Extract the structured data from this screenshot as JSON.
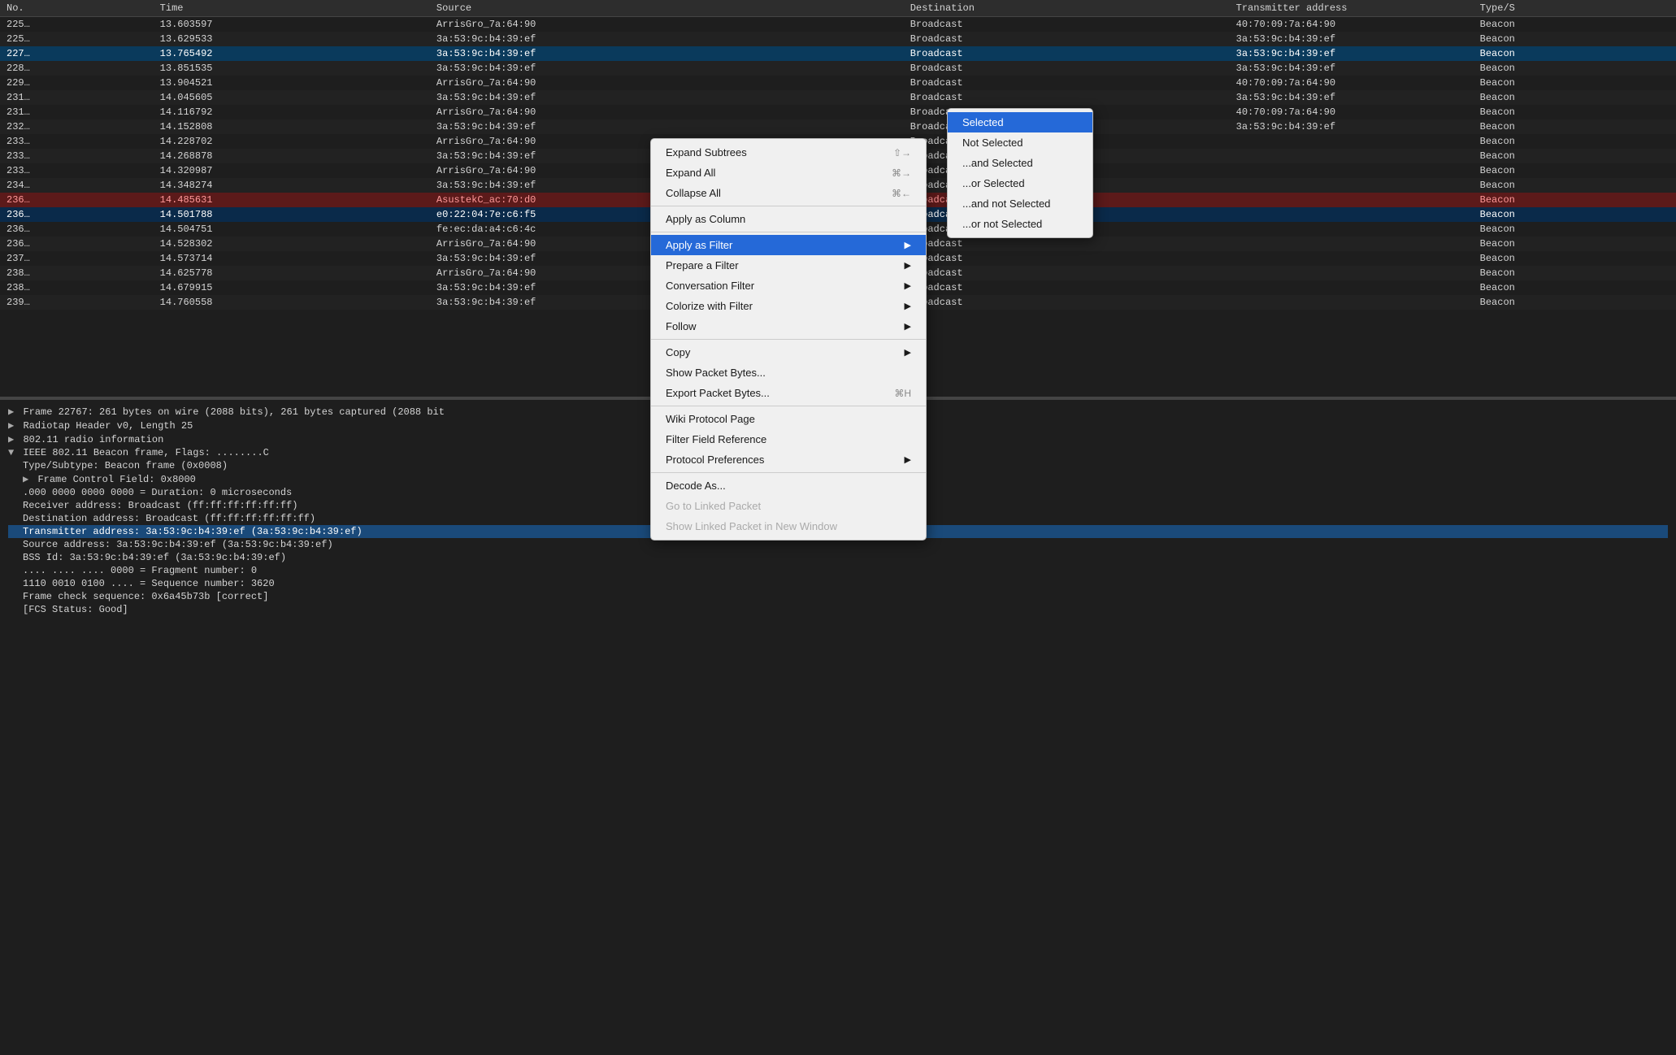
{
  "columns": [
    "No.",
    "Time",
    "Source",
    "Destination",
    "Transmitter address",
    "Type/S"
  ],
  "rows": [
    {
      "no": "225…",
      "time": "13.603597",
      "source": "ArrisGro_7a:64:90",
      "dest": "Broadcast",
      "transmitter": "40:70:09:7a:64:90",
      "type": "Beacon"
    },
    {
      "no": "225…",
      "time": "13.629533",
      "source": "3a:53:9c:b4:39:ef",
      "dest": "Broadcast",
      "transmitter": "3a:53:9c:b4:39:ef",
      "type": "Beacon"
    },
    {
      "no": "227…",
      "time": "13.765492",
      "source": "3a:53:9c:b4:39:ef",
      "dest": "Broadcast",
      "transmitter": "3a:53:9c:b4:39:ef",
      "type": "Beacon",
      "highlight": "selected"
    },
    {
      "no": "228…",
      "time": "13.851535",
      "source": "3a:53:9c:b4:39:ef",
      "dest": "Broadcast",
      "transmitter": "3a:53:9c:b4:39:ef",
      "type": "Beacon"
    },
    {
      "no": "229…",
      "time": "13.904521",
      "source": "ArrisGro_7a:64:90",
      "dest": "Broadcast",
      "transmitter": "40:70:09:7a:64:90",
      "type": "Beacon"
    },
    {
      "no": "231…",
      "time": "14.045605",
      "source": "3a:53:9c:b4:39:ef",
      "dest": "Broadcast",
      "transmitter": "3a:53:9c:b4:39:ef",
      "type": "Beacon"
    },
    {
      "no": "231…",
      "time": "14.116792",
      "source": "ArrisGro_7a:64:90",
      "dest": "Broadcast",
      "transmitter": "40:70:09:7a:64:90",
      "type": "Beacon"
    },
    {
      "no": "232…",
      "time": "14.152808",
      "source": "3a:53:9c:b4:39:ef",
      "dest": "Broadcast",
      "transmitter": "3a:53:9c:b4:39:ef",
      "type": "Beacon"
    },
    {
      "no": "233…",
      "time": "14.228702",
      "source": "ArrisGro_7a:64:90",
      "dest": "Broadcast",
      "transmitter": "",
      "type": "Beacon"
    },
    {
      "no": "233…",
      "time": "14.268878",
      "source": "3a:53:9c:b4:39:ef",
      "dest": "Broadcast",
      "transmitter": "",
      "type": "Beacon"
    },
    {
      "no": "233…",
      "time": "14.320987",
      "source": "ArrisGro_7a:64:90",
      "dest": "Broadcast",
      "transmitter": "",
      "type": "Beacon"
    },
    {
      "no": "234…",
      "time": "14.348274",
      "source": "3a:53:9c:b4:39:ef",
      "dest": "Broadcast",
      "transmitter": "",
      "type": "Beacon"
    },
    {
      "no": "236…",
      "time": "14.485631",
      "source": "AsustekC_ac:70:d0",
      "dest": "Broadcast",
      "transmitter": "",
      "type": "Beacon",
      "highlight": "red"
    },
    {
      "no": "236…",
      "time": "14.501788",
      "source": "e0:22:04:7e:c6:f5",
      "dest": "Broadcast",
      "transmitter": "",
      "type": "Beacon",
      "highlight": "dark"
    },
    {
      "no": "236…",
      "time": "14.504751",
      "source": "fe:ec:da:a4:c6:4c",
      "dest": "Broadcast",
      "transmitter": "",
      "type": "Beacon"
    },
    {
      "no": "236…",
      "time": "14.528302",
      "source": "ArrisGro_7a:64:90",
      "dest": "Broadcast",
      "transmitter": "",
      "type": "Beacon"
    },
    {
      "no": "237…",
      "time": "14.573714",
      "source": "3a:53:9c:b4:39:ef",
      "dest": "Broadcast",
      "transmitter": "",
      "type": "Beacon"
    },
    {
      "no": "238…",
      "time": "14.625778",
      "source": "ArrisGro_7a:64:90",
      "dest": "Broadcast",
      "transmitter": "",
      "type": "Beacon"
    },
    {
      "no": "238…",
      "time": "14.679915",
      "source": "3a:53:9c:b4:39:ef",
      "dest": "Broadcast",
      "transmitter": "",
      "type": "Beacon"
    },
    {
      "no": "239…",
      "time": "14.760558",
      "source": "3a:53:9c:b4:39:ef",
      "dest": "Broadcast",
      "transmitter": "",
      "type": "Beacon"
    }
  ],
  "detail_lines": [
    {
      "text": "Frame 22767: 261 bytes on wire (2088 bits), 261 bytes captured (2088 bit",
      "indent": 0,
      "arrow": "▶",
      "selected": false
    },
    {
      "text": "Radiotap Header v0, Length 25",
      "indent": 0,
      "arrow": "▶",
      "selected": false
    },
    {
      "text": "802.11 radio information",
      "indent": 0,
      "arrow": "▶",
      "selected": false
    },
    {
      "text": "IEEE 802.11 Beacon frame, Flags: ........C",
      "indent": 0,
      "arrow": "▼",
      "selected": false
    },
    {
      "text": "Type/Subtype: Beacon frame (0x0008)",
      "indent": 1,
      "arrow": "",
      "selected": false
    },
    {
      "text": "Frame Control Field: 0x8000",
      "indent": 1,
      "arrow": "▶",
      "selected": false
    },
    {
      "text": ".000 0000 0000 0000 = Duration: 0 microseconds",
      "indent": 1,
      "arrow": "",
      "selected": false
    },
    {
      "text": "Receiver address: Broadcast (ff:ff:ff:ff:ff:ff)",
      "indent": 1,
      "arrow": "",
      "selected": false
    },
    {
      "text": "Destination address: Broadcast (ff:ff:ff:ff:ff:ff)",
      "indent": 1,
      "arrow": "",
      "selected": false
    },
    {
      "text": "Transmitter address: 3a:53:9c:b4:39:ef (3a:53:9c:b4:39:ef)",
      "indent": 1,
      "arrow": "",
      "selected": true
    },
    {
      "text": "Source address: 3a:53:9c:b4:39:ef (3a:53:9c:b4:39:ef)",
      "indent": 1,
      "arrow": "",
      "selected": false
    },
    {
      "text": "BSS Id: 3a:53:9c:b4:39:ef (3a:53:9c:b4:39:ef)",
      "indent": 1,
      "arrow": "",
      "selected": false
    },
    {
      "text": ".... .... .... 0000 = Fragment number: 0",
      "indent": 1,
      "arrow": "",
      "selected": false
    },
    {
      "text": "1110 0010 0100 .... = Sequence number: 3620",
      "indent": 1,
      "arrow": "",
      "selected": false
    },
    {
      "text": "Frame check sequence: 0x6a45b73b [correct]",
      "indent": 1,
      "arrow": "",
      "selected": false
    },
    {
      "text": "[FCS Status: Good]",
      "indent": 1,
      "arrow": "",
      "selected": false
    }
  ],
  "context_menu": {
    "items": [
      {
        "label": "Expand Subtrees",
        "shortcut": "⇧→",
        "has_submenu": false,
        "disabled": false,
        "separator_after": false
      },
      {
        "label": "Expand All",
        "shortcut": "⌘→",
        "has_submenu": false,
        "disabled": false,
        "separator_after": false
      },
      {
        "label": "Collapse All",
        "shortcut": "⌘←",
        "has_submenu": false,
        "disabled": false,
        "separator_after": true
      },
      {
        "label": "Apply as Column",
        "shortcut": "",
        "has_submenu": false,
        "disabled": false,
        "separator_after": true
      },
      {
        "label": "Apply as Filter",
        "shortcut": "",
        "has_submenu": true,
        "disabled": false,
        "active": true,
        "separator_after": false
      },
      {
        "label": "Prepare a Filter",
        "shortcut": "",
        "has_submenu": true,
        "disabled": false,
        "separator_after": false
      },
      {
        "label": "Conversation Filter",
        "shortcut": "",
        "has_submenu": true,
        "disabled": false,
        "separator_after": false
      },
      {
        "label": "Colorize with Filter",
        "shortcut": "",
        "has_submenu": true,
        "disabled": false,
        "separator_after": false
      },
      {
        "label": "Follow",
        "shortcut": "",
        "has_submenu": true,
        "disabled": false,
        "separator_after": true
      },
      {
        "label": "Copy",
        "shortcut": "",
        "has_submenu": true,
        "disabled": false,
        "separator_after": false
      },
      {
        "label": "Show Packet Bytes...",
        "shortcut": "",
        "has_submenu": false,
        "disabled": false,
        "separator_after": false
      },
      {
        "label": "Export Packet Bytes...",
        "shortcut": "⌘H",
        "has_submenu": false,
        "disabled": false,
        "separator_after": true
      },
      {
        "label": "Wiki Protocol Page",
        "shortcut": "",
        "has_submenu": false,
        "disabled": false,
        "separator_after": false
      },
      {
        "label": "Filter Field Reference",
        "shortcut": "",
        "has_submenu": false,
        "disabled": false,
        "separator_after": false
      },
      {
        "label": "Protocol Preferences",
        "shortcut": "",
        "has_submenu": true,
        "disabled": false,
        "separator_after": true
      },
      {
        "label": "Decode As...",
        "shortcut": "",
        "has_submenu": false,
        "disabled": false,
        "separator_after": false
      },
      {
        "label": "Go to Linked Packet",
        "shortcut": "",
        "has_submenu": false,
        "disabled": true,
        "separator_after": false
      },
      {
        "label": "Show Linked Packet in New Window",
        "shortcut": "",
        "has_submenu": false,
        "disabled": true,
        "separator_after": false
      }
    ]
  },
  "apply_filter_submenu": {
    "items": [
      {
        "label": "Selected",
        "active": true
      },
      {
        "label": "Not Selected",
        "active": false
      },
      {
        "label": "...and Selected",
        "active": false
      },
      {
        "label": "...or Selected",
        "active": false
      },
      {
        "label": "...and not Selected",
        "active": false
      },
      {
        "label": "...or not Selected",
        "active": false
      }
    ]
  }
}
